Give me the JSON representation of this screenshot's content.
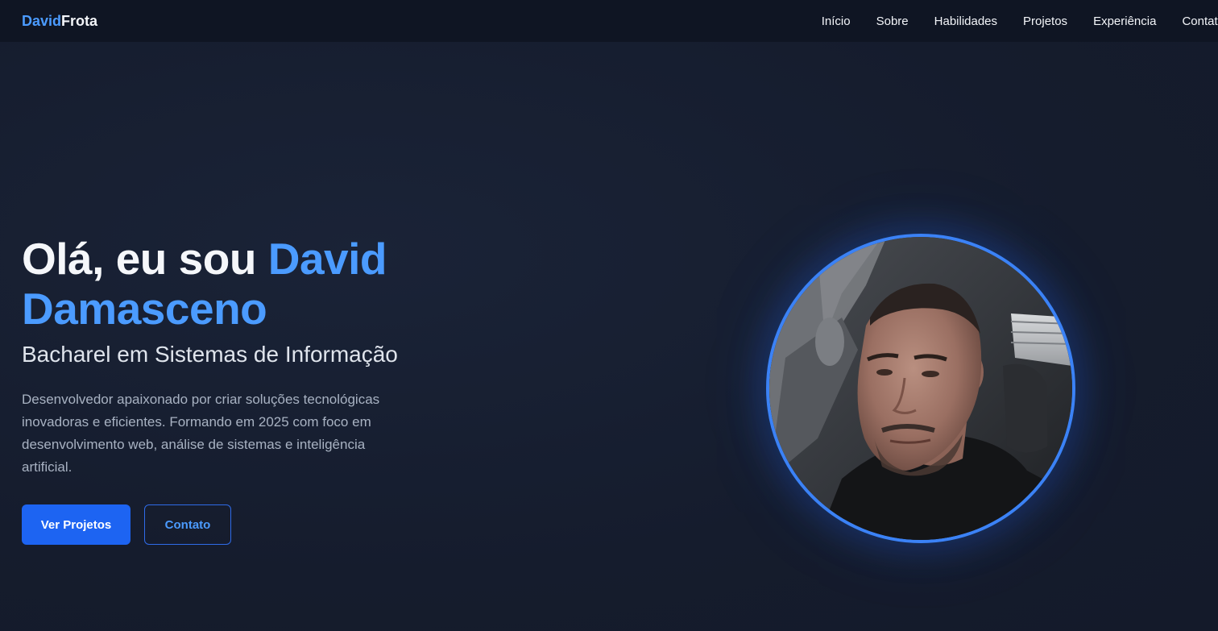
{
  "navbar": {
    "logo_first": "David",
    "logo_second": "Frota",
    "links": [
      "Início",
      "Sobre",
      "Habilidades",
      "Projetos",
      "Experiência",
      "Contato"
    ]
  },
  "hero": {
    "greeting": "Olá, eu sou ",
    "name_first": "David",
    "name_last": "Damasceno",
    "subtitle": "Bacharel em Sistemas de Informação",
    "description": "Desenvolvedor apaixonado por criar soluções tecnológicas inovadoras e eficientes. Formando em 2025 com foco em desenvolvimento web, análise de sistemas e inteligência artificial.",
    "primary_button": "Ver Projetos",
    "secondary_button": "Contato"
  },
  "colors": {
    "accent": "#4b9bff",
    "primary_button": "#1d64f2",
    "background": "#161e31",
    "navbar": "#0f1523"
  },
  "profile_image": {
    "icon": "profile-photo"
  }
}
